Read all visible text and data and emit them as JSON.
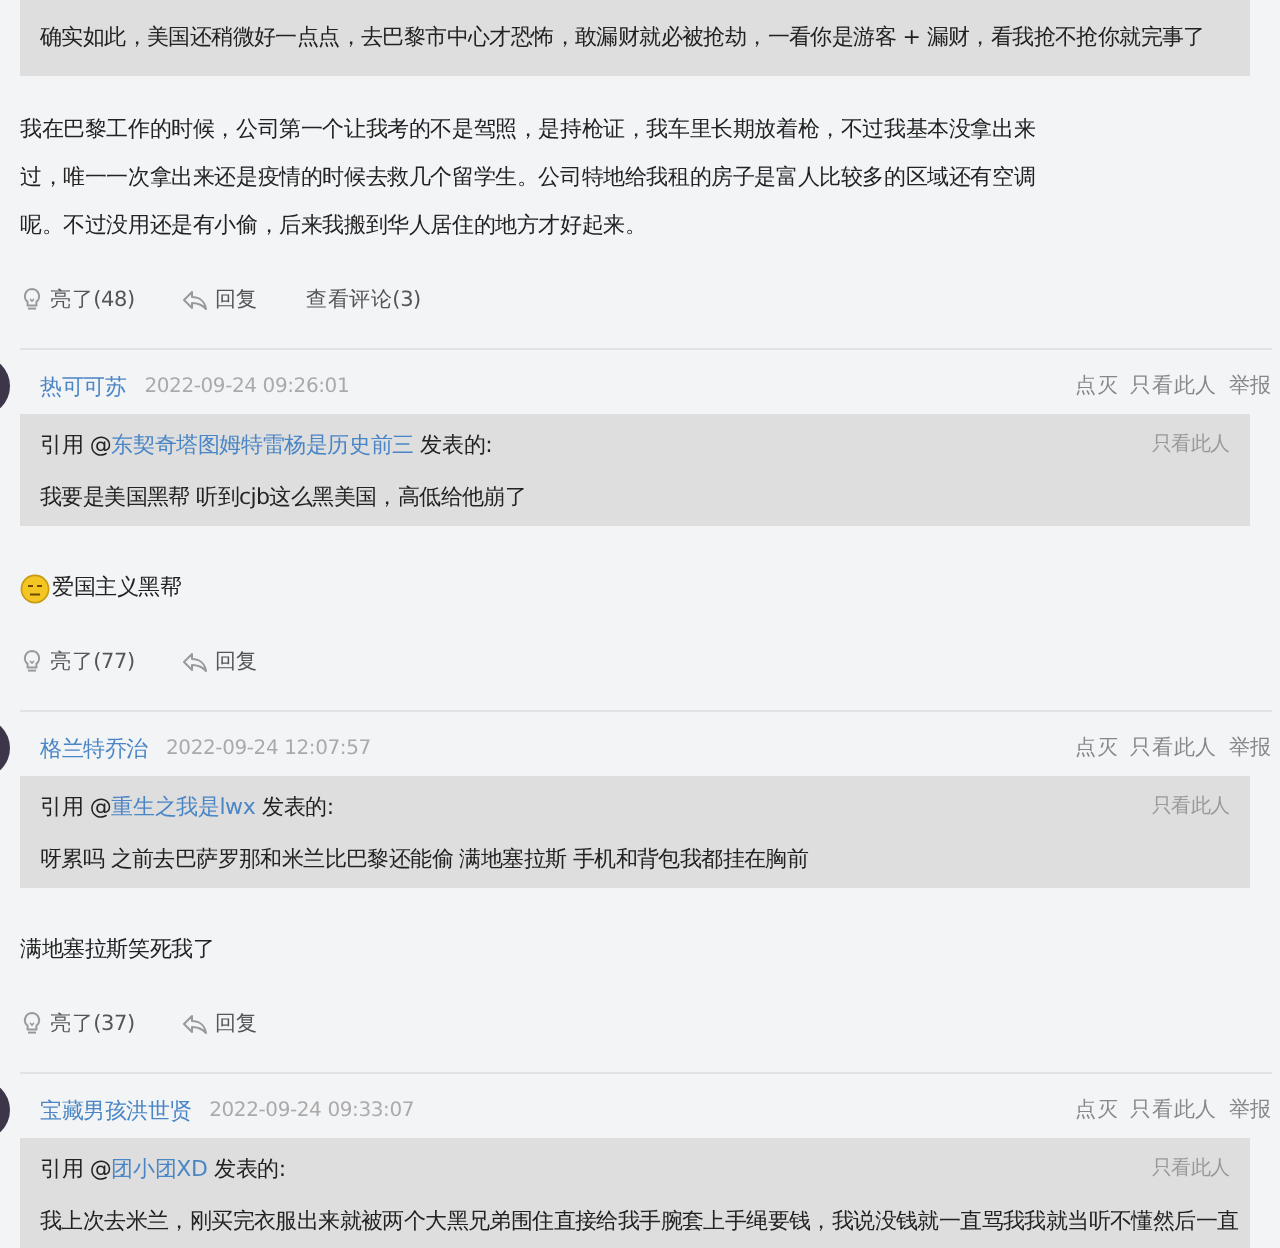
{
  "posts": [
    {
      "quote": {
        "text": "确实如此，美国还稍微好一点点，去巴黎市中心才恐怖，敢漏财就必被抢劫，一看你是游客 + 漏财，看我抢不抢你就完事了"
      },
      "body": {
        "text": "我在巴黎工作的时候，公司第一个让我考的不是驾照，是持枪证，我车里长期放着枪，不过我基本没拿出来过，唯一一次拿出来还是疫情的时候去救几个留学生。公司特地给我租的房子是富人比较多的区域还有空调呢。不过没用还是有小偷，后来我搬到华人居住的地方才好起来。",
        "emoji": false
      },
      "actions": [
        {
          "kind": "like",
          "label": "亮了(48)"
        },
        {
          "kind": "reply",
          "label": "回复"
        },
        {
          "kind": "comments",
          "label": "查看评论(3)"
        }
      ]
    },
    {
      "author": "热可可苏",
      "time": "2022-09-24 09:26:01",
      "links": [
        "点灭",
        "只看此人",
        "举报"
      ],
      "quote": {
        "prefix": "引用 @",
        "user": "东契奇塔图姆特雷杨是历史前三",
        "suffix": " 发表的:",
        "side_link": "只看此人",
        "text": "我要是美国黑帮 听到cjb这么黑美国，高低给他崩了"
      },
      "body": {
        "text": "爱国主义黑帮",
        "emoji": true
      },
      "actions": [
        {
          "kind": "like",
          "label": "亮了(77)"
        },
        {
          "kind": "reply",
          "label": "回复"
        }
      ]
    },
    {
      "author": "格兰特乔治",
      "time": "2022-09-24 12:07:57",
      "links": [
        "点灭",
        "只看此人",
        "举报"
      ],
      "quote": {
        "prefix": "引用 @",
        "user": "重生之我是lwx",
        "suffix": " 发表的:",
        "side_link": "只看此人",
        "text": "呀累吗 之前去巴萨罗那和米兰比巴黎还能偷 满地塞拉斯 手机和背包我都挂在胸前"
      },
      "body": {
        "text": "满地塞拉斯笑死我了",
        "emoji": false
      },
      "actions": [
        {
          "kind": "like",
          "label": "亮了(37)"
        },
        {
          "kind": "reply",
          "label": "回复"
        }
      ]
    },
    {
      "author": "宝藏男孩洪世贤",
      "time": "2022-09-24 09:33:07",
      "links": [
        "点灭",
        "只看此人",
        "举报"
      ],
      "quote": {
        "prefix": "引用 @",
        "user": "团小团XD",
        "suffix": " 发表的:",
        "side_link": "只看此人",
        "text": "我上次去米兰，刚买完衣服出来就被两个大黑兄弟围住直接给我手腕套上手绳要钱，我说没钱就一直骂我我就当听不懂然后一直"
      }
    }
  ]
}
